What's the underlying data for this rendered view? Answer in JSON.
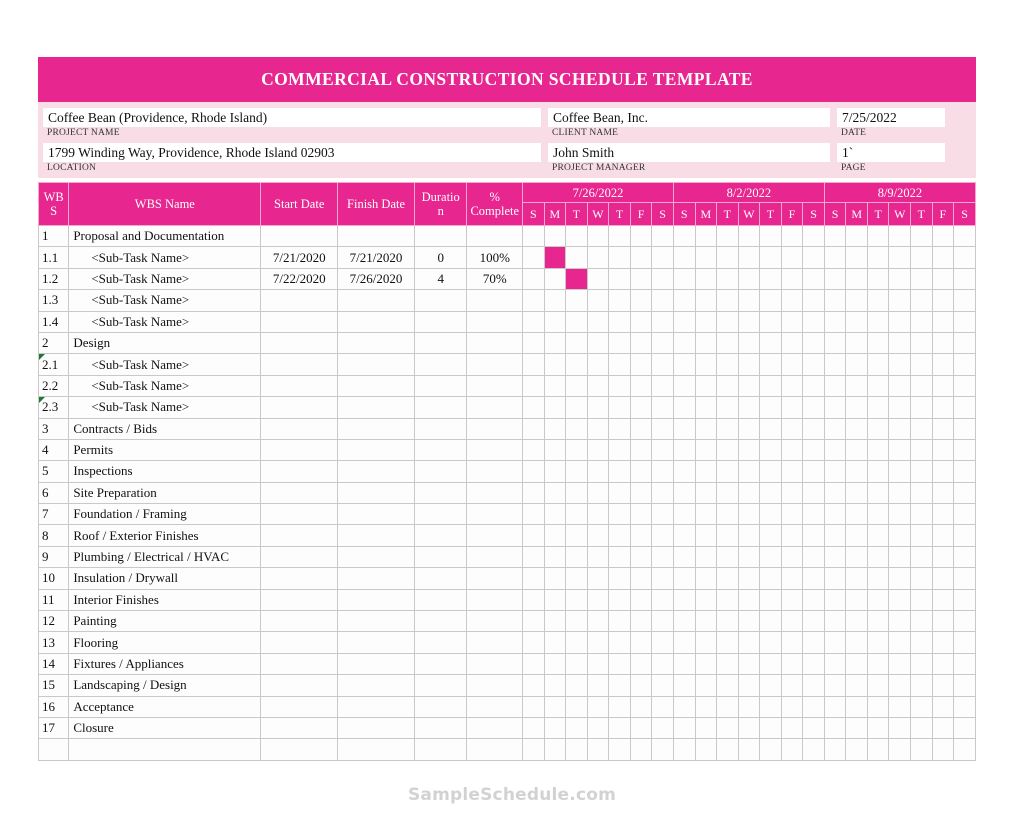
{
  "document": {
    "title": "COMMERCIAL CONSTRUCTION SCHEDULE TEMPLATE",
    "watermark": "SampleSchedule.com"
  },
  "colors": {
    "accent_pink": "#E8268F",
    "band_pink": "#F8DCE6",
    "grid_line": "#C9C9C9",
    "comment_marker_green": "#1E7A2E",
    "watermark_gray": "#D2D2D2"
  },
  "info": {
    "project_name": {
      "label": "PROJECT NAME",
      "value": "Coffee Bean (Providence, Rhode Island)"
    },
    "client_name": {
      "label": "CLIENT NAME",
      "value": "Coffee Bean, Inc."
    },
    "date": {
      "label": "DATE",
      "value": "7/25/2022"
    },
    "location": {
      "label": "LOCATION",
      "value": "1799  Winding Way, Providence, Rhode Island   02903"
    },
    "project_manager": {
      "label": "PROJECT MANAGER",
      "value": "John Smith"
    },
    "page": {
      "label": "PAGE",
      "value": "1`"
    }
  },
  "table": {
    "headers": {
      "wbs_line1": "WB",
      "wbs_line2": "S",
      "wbs_name": "WBS Name",
      "start_date": "Start Date",
      "finish_date": "Finish Date",
      "duration_line1": "Duratio",
      "duration_line2": "n",
      "percent_line1": "%",
      "percent_line2": "Complete"
    },
    "weeks": [
      {
        "label": "7/26/2022",
        "days": [
          "S",
          "M",
          "T",
          "W",
          "T",
          "F",
          "S"
        ]
      },
      {
        "label": "8/2/2022",
        "days": [
          "S",
          "M",
          "T",
          "W",
          "T",
          "F",
          "S"
        ]
      },
      {
        "label": "8/9/2022",
        "days": [
          "S",
          "M",
          "T",
          "W",
          "T",
          "F",
          "S"
        ]
      }
    ],
    "rows": [
      {
        "wbs": "1",
        "name": "Proposal and Documentation",
        "sub": false,
        "start": "",
        "finish": "",
        "duration": "",
        "percent": "",
        "bars": [],
        "comment": false
      },
      {
        "wbs": "1.1",
        "name": "<Sub-Task Name>",
        "sub": true,
        "start": "7/21/2020",
        "finish": "7/21/2020",
        "duration": "0",
        "percent": "100%",
        "bars": [
          1
        ],
        "comment": false
      },
      {
        "wbs": "1.2",
        "name": "<Sub-Task Name>",
        "sub": true,
        "start": "7/22/2020",
        "finish": "7/26/2020",
        "duration": "4",
        "percent": "70%",
        "bars": [
          2
        ],
        "comment": false
      },
      {
        "wbs": "1.3",
        "name": "<Sub-Task Name>",
        "sub": true,
        "start": "",
        "finish": "",
        "duration": "",
        "percent": "",
        "bars": [],
        "comment": false
      },
      {
        "wbs": "1.4",
        "name": "<Sub-Task Name>",
        "sub": true,
        "start": "",
        "finish": "",
        "duration": "",
        "percent": "",
        "bars": [],
        "comment": false
      },
      {
        "wbs": "2",
        "name": "Design",
        "sub": false,
        "start": "",
        "finish": "",
        "duration": "",
        "percent": "",
        "bars": [],
        "comment": false
      },
      {
        "wbs": "2.1",
        "name": "<Sub-Task Name>",
        "sub": true,
        "start": "",
        "finish": "",
        "duration": "",
        "percent": "",
        "bars": [],
        "comment": true
      },
      {
        "wbs": "2.2",
        "name": "<Sub-Task Name>",
        "sub": true,
        "start": "",
        "finish": "",
        "duration": "",
        "percent": "",
        "bars": [],
        "comment": false
      },
      {
        "wbs": "2.3",
        "name": "<Sub-Task Name>",
        "sub": true,
        "start": "",
        "finish": "",
        "duration": "",
        "percent": "",
        "bars": [],
        "comment": true
      },
      {
        "wbs": "3",
        "name": "Contracts / Bids",
        "sub": false,
        "start": "",
        "finish": "",
        "duration": "",
        "percent": "",
        "bars": [],
        "comment": false
      },
      {
        "wbs": "4",
        "name": "Permits",
        "sub": false,
        "start": "",
        "finish": "",
        "duration": "",
        "percent": "",
        "bars": [],
        "comment": false
      },
      {
        "wbs": "5",
        "name": "Inspections",
        "sub": false,
        "start": "",
        "finish": "",
        "duration": "",
        "percent": "",
        "bars": [],
        "comment": false
      },
      {
        "wbs": "6",
        "name": "Site Preparation",
        "sub": false,
        "start": "",
        "finish": "",
        "duration": "",
        "percent": "",
        "bars": [],
        "comment": false
      },
      {
        "wbs": "7",
        "name": "Foundation / Framing",
        "sub": false,
        "start": "",
        "finish": "",
        "duration": "",
        "percent": "",
        "bars": [],
        "comment": false
      },
      {
        "wbs": "8",
        "name": "Roof / Exterior Finishes",
        "sub": false,
        "start": "",
        "finish": "",
        "duration": "",
        "percent": "",
        "bars": [],
        "comment": false
      },
      {
        "wbs": "9",
        "name": "Plumbing / Electrical / HVAC",
        "sub": false,
        "start": "",
        "finish": "",
        "duration": "",
        "percent": "",
        "bars": [],
        "comment": false
      },
      {
        "wbs": "10",
        "name": "Insulation / Drywall",
        "sub": false,
        "start": "",
        "finish": "",
        "duration": "",
        "percent": "",
        "bars": [],
        "comment": false
      },
      {
        "wbs": "11",
        "name": "Interior Finishes",
        "sub": false,
        "start": "",
        "finish": "",
        "duration": "",
        "percent": "",
        "bars": [],
        "comment": false
      },
      {
        "wbs": "12",
        "name": "Painting",
        "sub": false,
        "start": "",
        "finish": "",
        "duration": "",
        "percent": "",
        "bars": [],
        "comment": false
      },
      {
        "wbs": "13",
        "name": "Flooring",
        "sub": false,
        "start": "",
        "finish": "",
        "duration": "",
        "percent": "",
        "bars": [],
        "comment": false
      },
      {
        "wbs": "14",
        "name": "Fixtures / Appliances",
        "sub": false,
        "start": "",
        "finish": "",
        "duration": "",
        "percent": "",
        "bars": [],
        "comment": false
      },
      {
        "wbs": "15",
        "name": "Landscaping / Design",
        "sub": false,
        "start": "",
        "finish": "",
        "duration": "",
        "percent": "",
        "bars": [],
        "comment": false
      },
      {
        "wbs": "16",
        "name": "Acceptance",
        "sub": false,
        "start": "",
        "finish": "",
        "duration": "",
        "percent": "",
        "bars": [],
        "comment": false
      },
      {
        "wbs": "17",
        "name": "Closure",
        "sub": false,
        "start": "",
        "finish": "",
        "duration": "",
        "percent": "",
        "bars": [],
        "comment": false
      },
      {
        "wbs": "",
        "name": "",
        "sub": false,
        "start": "",
        "finish": "",
        "duration": "",
        "percent": "",
        "bars": [],
        "comment": false
      }
    ]
  }
}
